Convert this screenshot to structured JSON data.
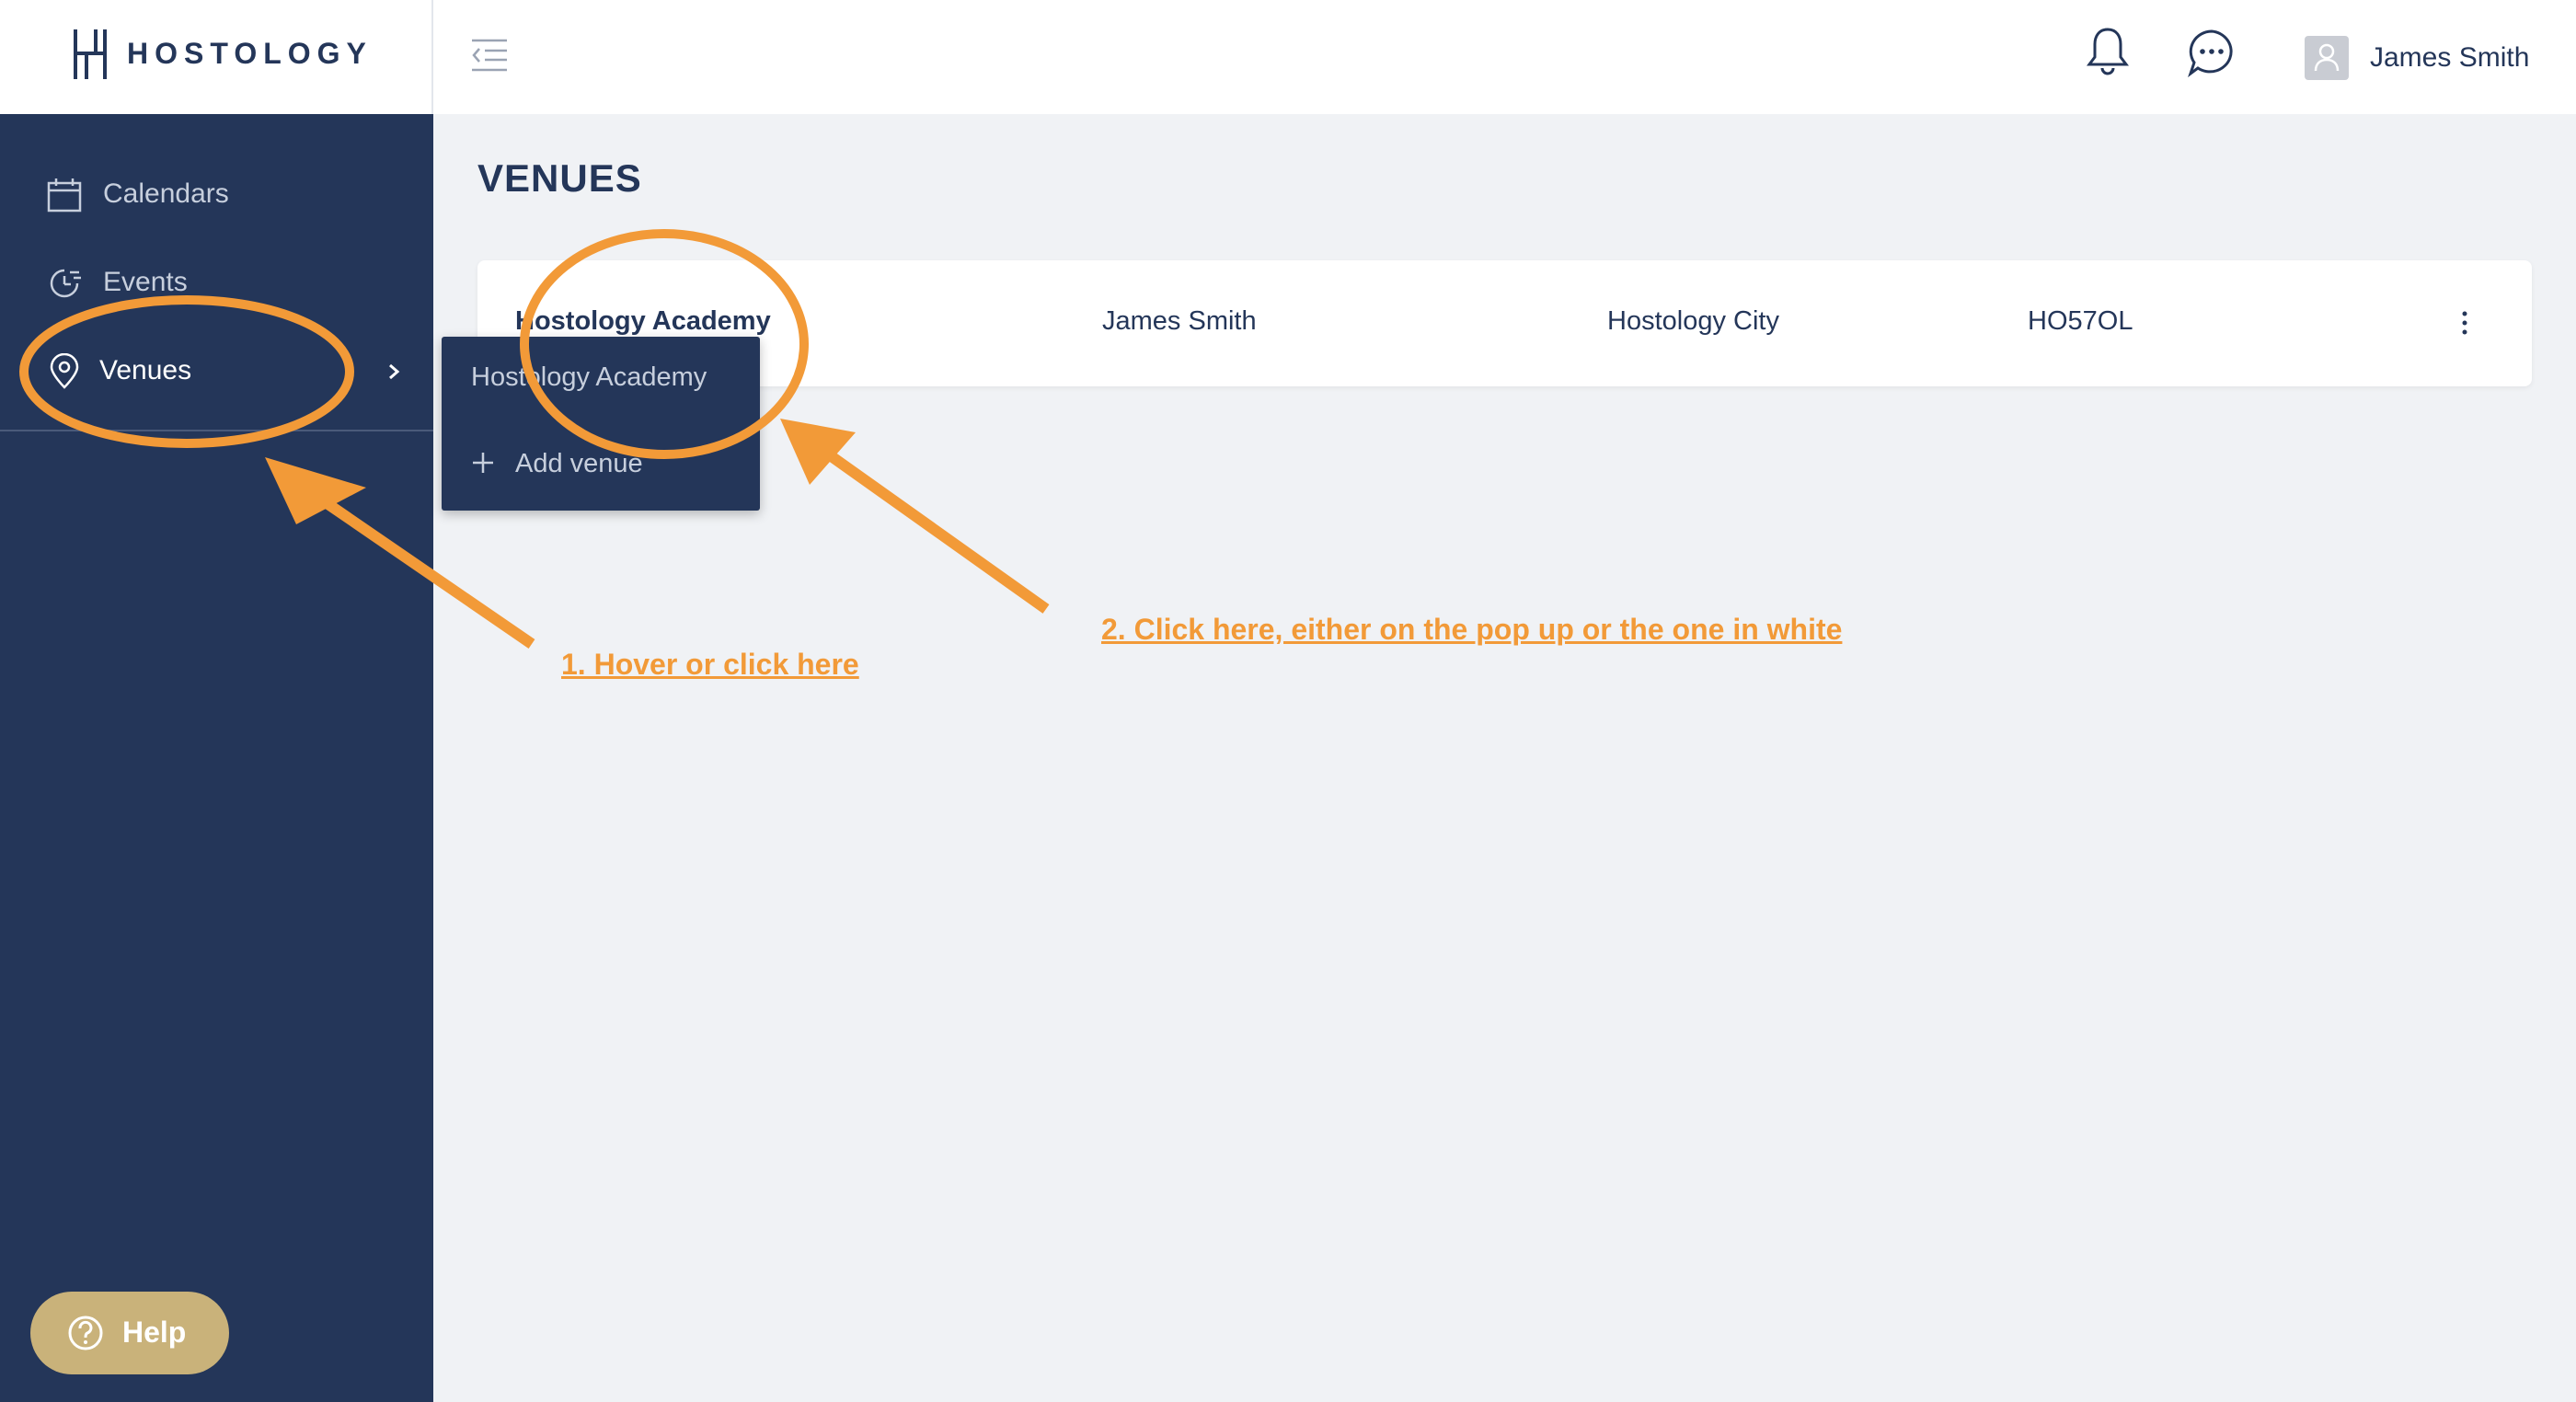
{
  "brand": {
    "name": "HOSTOLOGY"
  },
  "sidebar": {
    "items": [
      {
        "label": "Calendars",
        "icon": "calendar-icon"
      },
      {
        "label": "Events",
        "icon": "clock-icon"
      },
      {
        "label": "Venues",
        "icon": "location-pin-icon",
        "active": true
      }
    ],
    "help_label": "Help"
  },
  "header": {
    "user_name": "James Smith"
  },
  "page": {
    "title": "VENUES"
  },
  "venues": {
    "rows": [
      {
        "name": "Hostology Academy",
        "owner": "James Smith",
        "city": "Hostology City",
        "code": "HO57OL"
      }
    ]
  },
  "popup": {
    "venue_item": "Hostology Academy",
    "add_label": "Add venue"
  },
  "annotations": {
    "step1": "1. Hover or click here",
    "step2": "2. Click here, either on the pop up or the one in white",
    "color": "#f29a38"
  },
  "colors": {
    "sidebar_bg": "#243659",
    "accent_orange": "#f29a38",
    "help_gold": "#c9b27a",
    "page_bg": "#f0f2f5"
  }
}
